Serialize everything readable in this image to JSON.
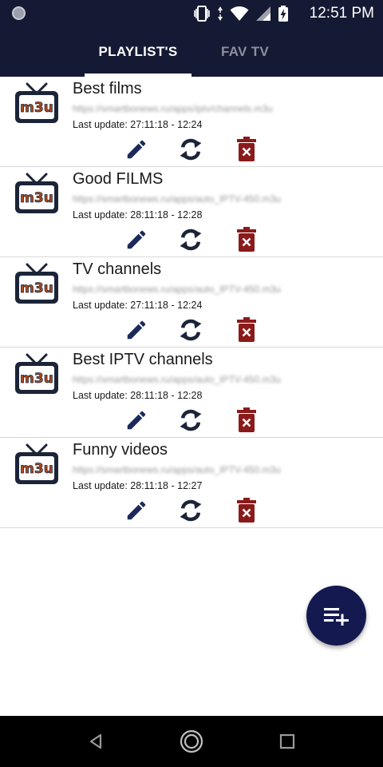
{
  "status": {
    "time": "12:51 PM"
  },
  "tabs": [
    {
      "label": "PLAYLIST'S",
      "active": true
    },
    {
      "label": "FAV TV",
      "active": false
    }
  ],
  "logo_text": "m3u",
  "playlists": [
    {
      "title": "Best films",
      "url": "https://smartbonews.ru/apps/iptv/channels.m3u",
      "updated": "Last update: 27:11:18 - 12:24"
    },
    {
      "title": "Good FILMS",
      "url": "https://smartbonews.ru/apps/auto_IPTV-450.m3u",
      "updated": "Last update: 28:11:18 - 12:28"
    },
    {
      "title": "TV channels",
      "url": "https://smartbonews.ru/apps/auto_IPTV-450.m3u",
      "updated": "Last update: 27:11:18 - 12:24"
    },
    {
      "title": "Best IPTV channels",
      "url": "https://smartbonews.ru/apps/auto_IPTV-450.m3u",
      "updated": "Last update: 28:11:18 - 12:28"
    },
    {
      "title": "Funny videos",
      "url": "https://smartbonews.ru/apps/auto_IPTV-450.m3u",
      "updated": "Last update: 28:11:18 - 12:27"
    }
  ],
  "colors": {
    "header_bg": "#141a33",
    "icon_blue": "#1c2a5a",
    "delete_red": "#8b1a1a",
    "fab_bg": "#141a4f",
    "logo_text": "#b04a1a"
  }
}
